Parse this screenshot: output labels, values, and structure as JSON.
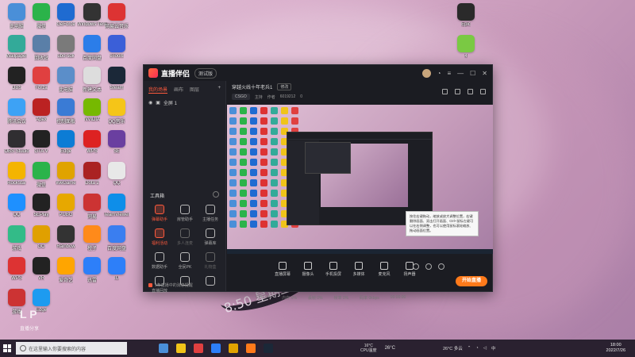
{
  "desktop_icons": [
    {
      "label": "此电脑",
      "color": "#4a8fd8"
    },
    {
      "label": "微信",
      "color": "#2bb34a"
    },
    {
      "label": "GeForce",
      "color": "#1f6bd1"
    },
    {
      "label": "Windows Terminal",
      "color": "#333"
    },
    {
      "label": "网易云音乐",
      "color": "#d33"
    },
    {
      "label": "Wallpaper",
      "color": "#3a9"
    },
    {
      "label": "回收站",
      "color": "#5a7fa8"
    },
    {
      "label": "ubo-sdk",
      "color": "#7a7a7a"
    },
    {
      "label": "百度网盘",
      "color": "#2b7de9"
    },
    {
      "label": "uTools",
      "color": "#3b5fd8"
    },
    {
      "label": "OBS",
      "color": "#222"
    },
    {
      "label": "Forza",
      "color": "#e04040"
    },
    {
      "label": "此电脑",
      "color": "#5b8ec9"
    },
    {
      "label": "新建文本",
      "color": "#ddd"
    },
    {
      "label": "Steam",
      "color": "#1b2838"
    },
    {
      "label": "腾讯会议",
      "color": "#3da2f5"
    },
    {
      "label": "Apex",
      "color": "#b22"
    },
    {
      "label": "控制面板",
      "color": "#3a7bd5"
    },
    {
      "label": "NVIDIA",
      "color": "#76b900"
    },
    {
      "label": "QQ音乐",
      "color": "#f5c518"
    },
    {
      "label": "OBS Studio",
      "color": "#302e31"
    },
    {
      "label": "GTA V",
      "color": "#222"
    },
    {
      "label": "Edge",
      "color": "#0c7cd5"
    },
    {
      "label": "WPS",
      "color": "#d22"
    },
    {
      "label": "SE",
      "color": "#6a3fa0"
    },
    {
      "label": "Rockstar",
      "color": "#f4b400"
    },
    {
      "label": "微信",
      "color": "#2bb34a"
    },
    {
      "label": "WeGame",
      "color": "#e0a300"
    },
    {
      "label": "Dota 2",
      "color": "#a22"
    },
    {
      "label": "QQ",
      "color": "#e8e8e8"
    },
    {
      "label": "QQ",
      "color": "#1e90ff"
    },
    {
      "label": "5EPlay",
      "color": "#222"
    },
    {
      "label": "PUBG",
      "color": "#e7a800"
    },
    {
      "label": "网易",
      "color": "#c33"
    },
    {
      "label": "TeamViewer",
      "color": "#0e8ee9"
    },
    {
      "label": "游戏",
      "color": "#3b8"
    },
    {
      "label": "GO",
      "color": "#e0a000"
    },
    {
      "label": "Rainbow",
      "color": "#333"
    },
    {
      "label": "橙子",
      "color": "#ff8a1a"
    },
    {
      "label": "百度网盘",
      "color": "#3a7ef0"
    },
    {
      "label": "WPS",
      "color": "#d33"
    },
    {
      "label": "VR",
      "color": "#222"
    },
    {
      "label": "爱奇艺",
      "color": "#ffa500"
    },
    {
      "label": "迅雷",
      "color": "#2d7ff9"
    },
    {
      "label": "IU",
      "color": "#2d7ff9"
    },
    {
      "label": "游戏",
      "color": "#c33"
    },
    {
      "label": "Edge",
      "color": "#1d9bf0"
    }
  ],
  "right_icons": [
    {
      "label": "Epic",
      "color": "#2a2a2a"
    },
    {
      "label": "4",
      "color": "#7ac943"
    }
  ],
  "app": {
    "name": "直播伴侣",
    "version_badge": "测试版",
    "tabs": [
      "我的场景",
      "画布",
      "图层"
    ],
    "scene_label": "全屏 1",
    "tools_title": "工具箱",
    "tools": [
      {
        "label": "弹幕助手",
        "state": "hot"
      },
      {
        "label": "房管助手",
        "state": "normal"
      },
      {
        "label": "主播任务",
        "state": "normal"
      },
      {
        "label": "福利活动",
        "state": "hot"
      },
      {
        "label": "多人连麦",
        "state": "dim"
      },
      {
        "label": "弹幕库",
        "state": "normal"
      },
      {
        "label": "数据助手",
        "state": "normal"
      },
      {
        "label": "全民PK",
        "state": "normal"
      },
      {
        "label": "礼物盒",
        "state": "dim"
      },
      {
        "label": "直播回放",
        "state": "normal"
      },
      {
        "label": "",
        "state": "normal"
      },
      {
        "label": "",
        "state": "normal"
      }
    ],
    "notice": "1条直播中的消息提醒",
    "room_title": "穿越火线十年老兵1",
    "edit_label": "修改",
    "room_meta": [
      "CSGO",
      "主持",
      "作者",
      "6019212",
      "0"
    ],
    "bottom_buttons": [
      "直播屏幕",
      "摄像头",
      "手机投屏",
      "多媒体",
      "麦克风",
      "扬声器"
    ],
    "go_live_label": "开始直播",
    "stats": [
      "CPU 0%",
      "内存 0%",
      "丢帧 0%",
      "帧率 0%",
      "码率 0kbps",
      "00:00:00"
    ],
    "tooltip": "按住右键拖动，缩放或放大调整位置，右键删除画面、双击打开画面、Ctrl+鼠标左键可以在右侧调整，也可以使用鼠标滚轮缩放、拖动画面位置。"
  },
  "wallpaper": {
    "choker_text": "8:50 星期二"
  },
  "watermark": {
    "text": "L P",
    "sub": "直播分享"
  },
  "taskbar": {
    "search_placeholder": "在这里输入你要搜索的内容",
    "apps": [
      "#4a8fd8",
      "#f0c419",
      "#e04040",
      "#2d7ff9",
      "#e0a300",
      "#ff7a1a",
      "#1b2838"
    ],
    "weather_line1": "16°C",
    "weather_line2": "CPU温度",
    "temp": "26°C",
    "tray_temp": "26°C 多云",
    "clock_time": "18:00",
    "clock_date": "2022/7/26"
  }
}
